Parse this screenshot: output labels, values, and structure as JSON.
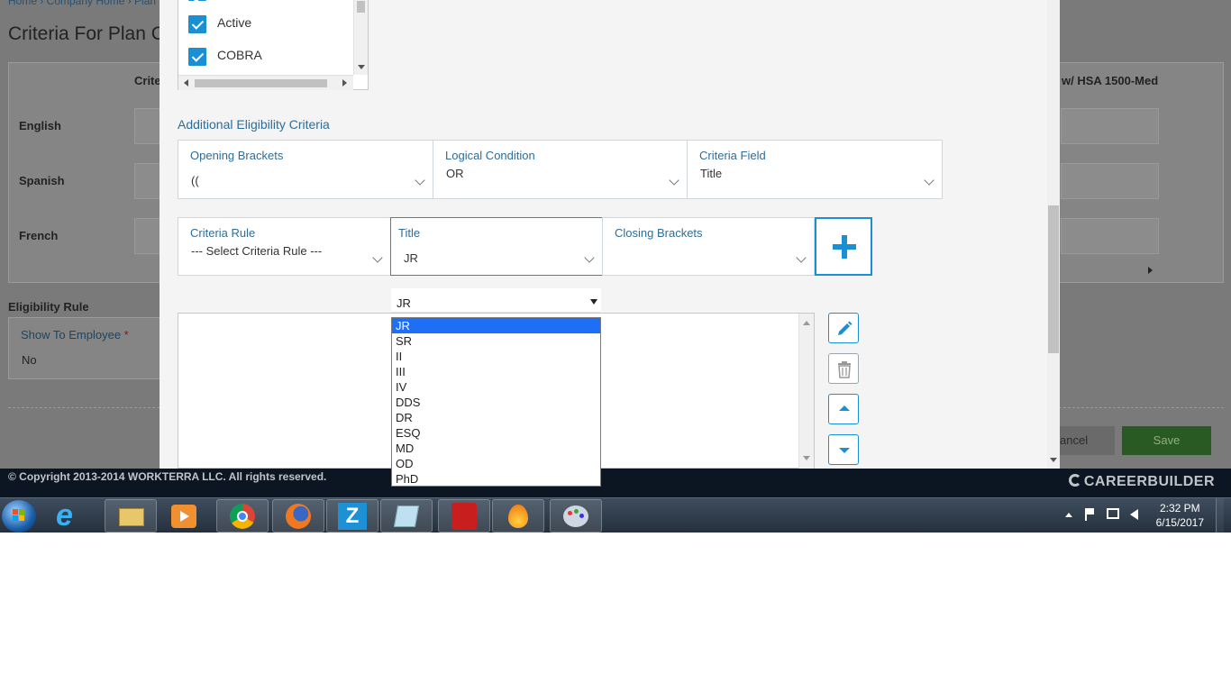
{
  "background": {
    "breadcrumb": "Home › Company Home › Plan",
    "page_title": "Criteria For Plan C",
    "column_header_left": "Crite",
    "column_header_right": "w/ HSA 1500-Med",
    "languages": [
      "English",
      "Spanish",
      "French"
    ],
    "eligibility_rule_label": "Eligibility Rule",
    "show_to_employee_label": "Show To Employee",
    "show_to_employee_required": "*",
    "show_to_employee_value": "No",
    "cancel_label": "ancel",
    "save_label": "Save"
  },
  "modal": {
    "status_checkboxes": [
      {
        "label": "Active",
        "checked": true
      },
      {
        "label": "COBRA",
        "checked": true
      }
    ],
    "additional_criteria_title": "Additional Eligibility Criteria",
    "opening_brackets": {
      "label": "Opening Brackets",
      "value": "(("
    },
    "logical_condition": {
      "label": "Logical Condition",
      "value": "OR"
    },
    "criteria_field": {
      "label": "Criteria Field",
      "value": "Title"
    },
    "criteria_rule": {
      "label": "Criteria Rule",
      "value": "--- Select Criteria Rule ---"
    },
    "title_field": {
      "label": "Title",
      "value": "JR"
    },
    "closing_brackets": {
      "label": "Closing Brackets",
      "value": ""
    },
    "add_icon": "plus-icon",
    "list_select_value": "JR",
    "title_options": [
      "JR",
      "SR",
      "II",
      "III",
      "IV",
      "DDS",
      "DR",
      "ESQ",
      "MD",
      "OD",
      "PhD"
    ],
    "selected_option": "JR"
  },
  "footer": {
    "copyright": "© Copyright 2013-2014 WORKTERRA LLC. All rights reserved.",
    "logo": "CAREERBUILDER"
  },
  "taskbar": {
    "time": "2:32 PM",
    "date": "6/15/2017",
    "apps": [
      "start-orb",
      "internet-explorer",
      "file-explorer",
      "media-player",
      "chrome",
      "firefox",
      "z-app",
      "notepad-app",
      "adobe-reader",
      "flame-app",
      "paint-app"
    ]
  },
  "colors": {
    "accent": "#1b8fd3",
    "label_blue": "#2f6d97",
    "save_green": "#3f9b3b",
    "selected_option": "#1e6ff5"
  }
}
